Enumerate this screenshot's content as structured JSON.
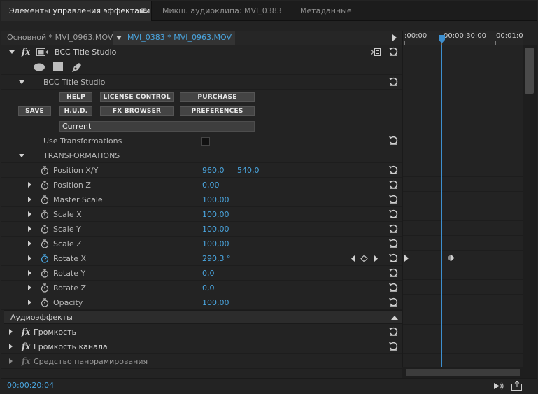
{
  "tabs": {
    "effect_controls": "Элементы управления эффектами",
    "menu": "≡",
    "audio_clip_mixer": "Микш. аудиоклипа: MVI_0383",
    "metadata": "Метаданные"
  },
  "header": {
    "master_clip": "Основной * MVI_0963.MOV",
    "current_clip": "MVI_0383 * MVI_0963.MOV"
  },
  "ruler": {
    "labels": [
      ":00:00",
      "00:00:30:00",
      "00:01:0"
    ]
  },
  "effect": {
    "name": "BCC Title Studio",
    "group_label": "BCC Title Studio",
    "buttons": {
      "help": "HELP",
      "license": "LICENSE CONTROL",
      "purchase": "PURCHASE",
      "save": "SAVE",
      "hud": "H.U.D.",
      "fx_browser": "FX BROWSER",
      "preferences": "PREFERENCES"
    },
    "preset_value": "Current",
    "use_transformations": "Use Transformations",
    "transformations": "TRANSFORMATIONS"
  },
  "properties": [
    {
      "label": "Position X/Y",
      "value": "960,0",
      "value2": "540,0"
    },
    {
      "label": "Position Z",
      "value": "0,00"
    },
    {
      "label": "Master Scale",
      "value": "100,00"
    },
    {
      "label": "Scale X",
      "value": "100,00"
    },
    {
      "label": "Scale Y",
      "value": "100,00"
    },
    {
      "label": "Scale Z",
      "value": "100,00"
    },
    {
      "label": "Rotate X",
      "value": "290,3 °"
    },
    {
      "label": "Rotate Y",
      "value": "0,0"
    },
    {
      "label": "Rotate Z",
      "value": "0,0"
    },
    {
      "label": "Opacity",
      "value": "100,00"
    }
  ],
  "audio": {
    "section": "Аудиоэффекты",
    "volume": "Громкость",
    "channel_volume": "Громкость канала",
    "panner": "Средство панорамирования"
  },
  "footer": {
    "timecode": "00:00:20:04"
  },
  "colors": {
    "accent": "#4aa6e0",
    "background": "#232323"
  }
}
